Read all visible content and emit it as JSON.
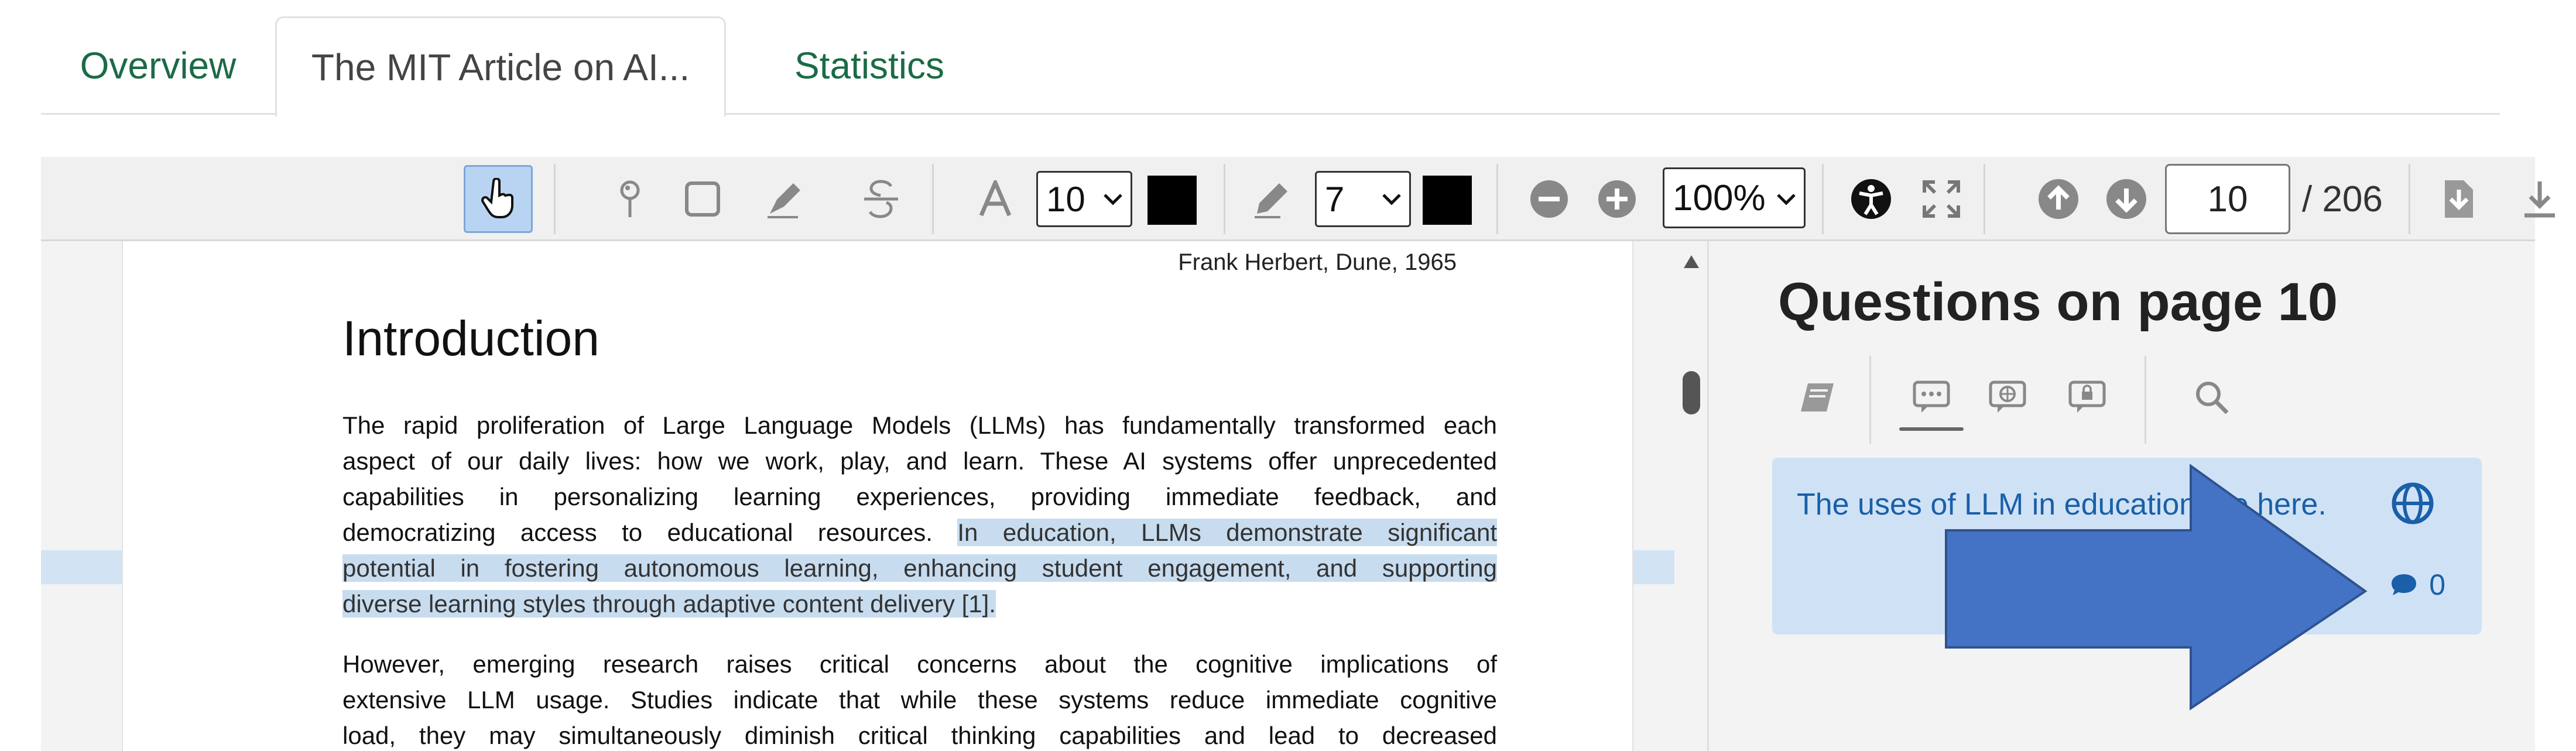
{
  "tabs": [
    {
      "label": "Overview",
      "active": false
    },
    {
      "label": "The MIT Article on AI...",
      "active": true
    },
    {
      "label": "Statistics",
      "active": false
    }
  ],
  "toolbar": {
    "icons": [
      "hand-pointer-icon",
      "pin-icon",
      "rectangle-icon",
      "highlighter-icon",
      "strikethrough-icon",
      "text-icon",
      "pencil-icon",
      "zoom-out-icon",
      "zoom-in-icon",
      "accessibility-icon",
      "fullscreen-icon",
      "page-up-icon",
      "page-down-icon",
      "export-icon",
      "download-icon"
    ],
    "font_size": "10",
    "pen_size": "7",
    "zoom": "100%",
    "page_current": "10",
    "page_total": "/ 206",
    "text_color": "#000000",
    "pen_color": "#000000"
  },
  "document": {
    "credit": "Frank Herbert, Dune, 1965",
    "heading": "Introduction",
    "para1_lines": [
      {
        "text": "The rapid proliferation of Large Language Models (LLMs) has fundamentally transformed each"
      },
      {
        "text": "aspect of our daily lives: how we work, play, and learn. These AI systems offer unprecedented"
      },
      {
        "text": "capabilities in personalizing learning experiences, providing immediate feedback, and"
      },
      {
        "pre": "democratizing access to educational resources. ",
        "hl": "In education, LLMs demonstrate significant"
      },
      {
        "hl": "potential in fostering autonomous learning, enhancing student engagement, and supporting"
      },
      {
        "hl": "diverse learning styles through adaptive content delivery [1].",
        "last": true
      }
    ],
    "para2_lines": [
      {
        "text": "However, emerging research raises critical concerns about the cognitive implications of"
      },
      {
        "text": "extensive LLM usage. Studies indicate that while these systems reduce immediate cognitive"
      },
      {
        "text": "load, they may simultaneously diminish critical thinking capabilities and lead to decreased"
      }
    ],
    "highlight_color": "#c8dcef"
  },
  "panel": {
    "title": "Questions on page 10",
    "filters": [
      "book-icon",
      "chat-bubble-icon",
      "globe-bubble-icon",
      "lock-bubble-icon",
      "search-icon"
    ],
    "question": {
      "text": "The uses of LLM in education are here.",
      "comments": "0"
    },
    "accent": "#1a5fa8"
  },
  "overlay": {
    "arrow_color": "#4472c4"
  }
}
